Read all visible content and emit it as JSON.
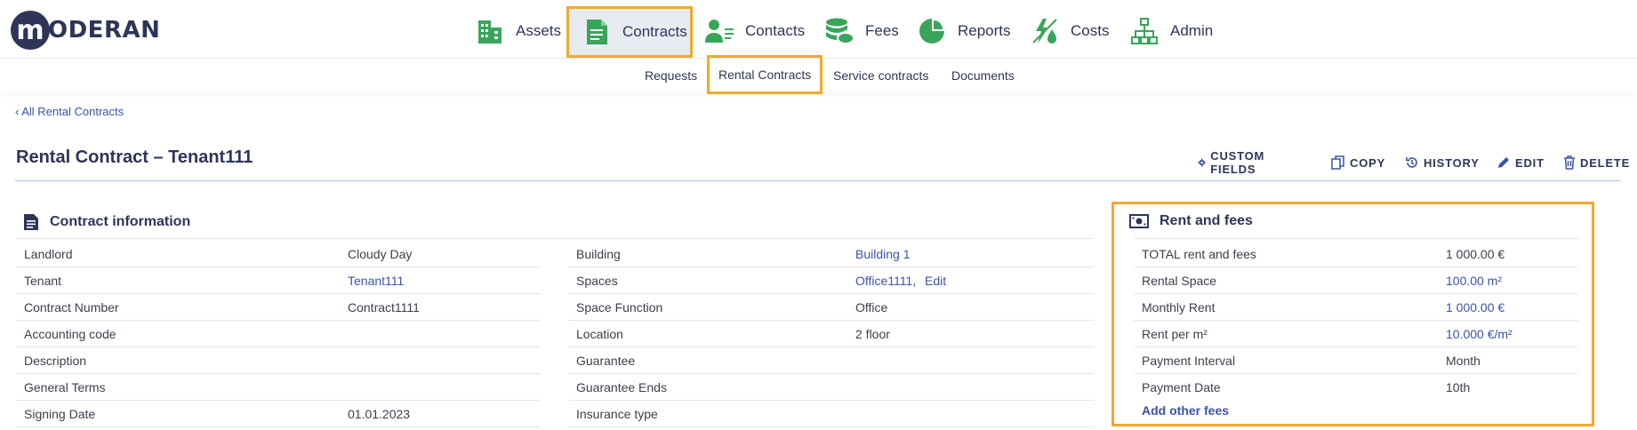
{
  "logo": {
    "letter": "m",
    "text": "ODERAN"
  },
  "nav": {
    "items": [
      {
        "label": "Assets",
        "icon": "building-icon"
      },
      {
        "label": "Contracts",
        "icon": "document-icon",
        "active": true
      },
      {
        "label": "Contacts",
        "icon": "contact-icon"
      },
      {
        "label": "Fees",
        "icon": "coins-icon"
      },
      {
        "label": "Reports",
        "icon": "pie-chart-icon"
      },
      {
        "label": "Costs",
        "icon": "utilities-icon"
      },
      {
        "label": "Admin",
        "icon": "org-chart-icon"
      }
    ]
  },
  "subnav": {
    "items": [
      {
        "label": "Requests"
      },
      {
        "label": "Rental Contracts",
        "active": true
      },
      {
        "label": "Service contracts"
      },
      {
        "label": "Documents"
      }
    ]
  },
  "back_link": "All Rental Contracts",
  "page_title": "Rental Contract – Tenant111",
  "actions": {
    "custom_fields": "CUSTOM FIELDS",
    "copy": "COPY",
    "history": "HISTORY",
    "edit": "EDIT",
    "delete": "DELETE"
  },
  "contract_info": {
    "title": "Contract information",
    "left": [
      {
        "label": "Landlord",
        "value": "Cloudy Day"
      },
      {
        "label": "Tenant",
        "value": "Tenant111"
      },
      {
        "label": "Contract Number",
        "value": "Contract1111"
      },
      {
        "label": "Accounting code",
        "value": ""
      },
      {
        "label": "Description",
        "value": ""
      },
      {
        "label": "General Terms",
        "value": ""
      },
      {
        "label": "Signing Date",
        "value": "01.01.2023"
      }
    ],
    "right": [
      {
        "label": "Building",
        "value": "Building 1"
      },
      {
        "label": "Spaces",
        "value": "Office1111,",
        "extra": "Edit"
      },
      {
        "label": "Space Function",
        "value": "Office"
      },
      {
        "label": "Location",
        "value": "2 floor"
      },
      {
        "label": "Guarantee",
        "value": ""
      },
      {
        "label": "Guarantee Ends",
        "value": ""
      },
      {
        "label": "Insurance type",
        "value": ""
      }
    ]
  },
  "rent_fees": {
    "title": "Rent and fees",
    "rows": [
      {
        "label": "TOTAL rent and fees",
        "value": "1 000.00 €"
      },
      {
        "label": "Rental Space",
        "value": "100.00 m²"
      },
      {
        "label": "Monthly Rent",
        "value": "1 000.00 €"
      },
      {
        "label": "Rent per m²",
        "value": "10.000 €/m²"
      },
      {
        "label": "Payment Interval",
        "value": "Month"
      },
      {
        "label": "Payment Date",
        "value": "10th"
      }
    ],
    "add_other_fees": "Add other fees"
  },
  "colors": {
    "accent_highlight": "#f0a92e",
    "brand": "#2e3557",
    "link": "#3b53a6",
    "nav_icon_green": "#3aa55a"
  }
}
